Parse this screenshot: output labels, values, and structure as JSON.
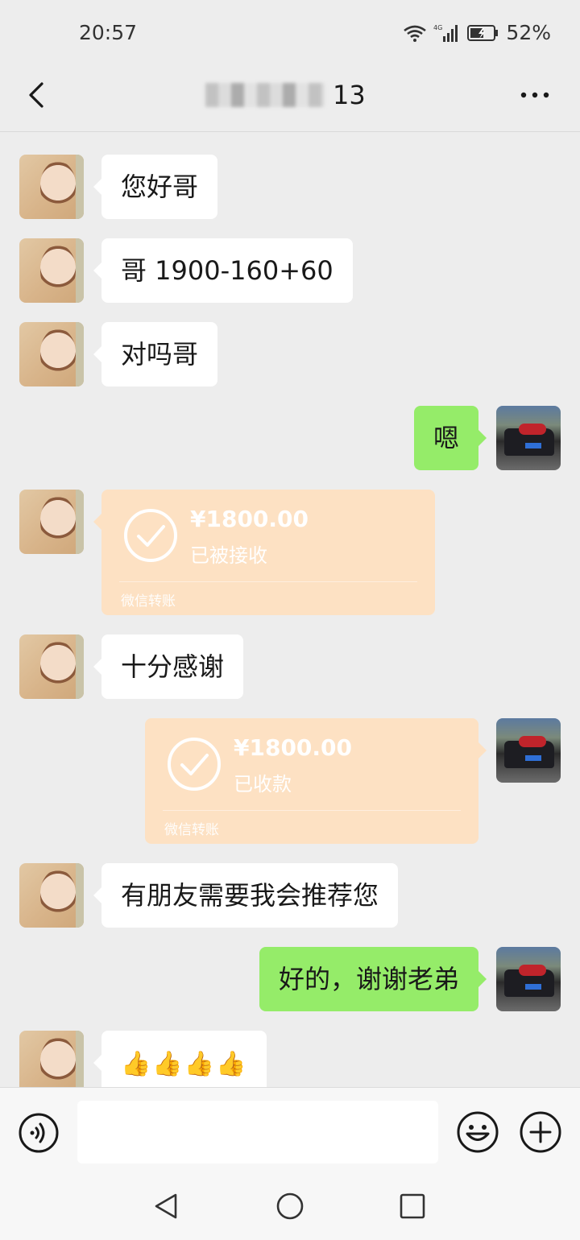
{
  "status_bar": {
    "time": "20:57",
    "network": "4G",
    "battery": "52%"
  },
  "header": {
    "title_suffix": "13"
  },
  "messages": [
    {
      "side": "left",
      "text": "您好哥"
    },
    {
      "side": "left",
      "text": "哥 1900-160+60"
    },
    {
      "side": "left",
      "text": "对吗哥"
    },
    {
      "side": "right",
      "text": "嗯"
    },
    {
      "side": "left",
      "type": "transfer",
      "amount": "¥1800.00",
      "status": "已被接收",
      "brand": "微信转账"
    },
    {
      "side": "left",
      "text": "十分感谢"
    },
    {
      "side": "right",
      "type": "transfer",
      "amount": "¥1800.00",
      "status": "已收款",
      "brand": "微信转账"
    },
    {
      "side": "left",
      "text": "有朋友需要我会推荐您"
    },
    {
      "side": "right",
      "text": "好的，谢谢老弟"
    },
    {
      "side": "left",
      "text": "👍👍👍👍"
    }
  ],
  "input": {
    "placeholder": ""
  },
  "icons": [
    "back-icon",
    "more-icon",
    "check-circle-icon",
    "voice-icon",
    "emoji-icon",
    "plus-icon",
    "nav-back-icon",
    "nav-home-icon",
    "nav-recents-icon"
  ],
  "colors": {
    "background": "#ededed",
    "incoming_bubble": "#ffffff",
    "outgoing_bubble": "#95ec69",
    "transfer_card": "#fde1c3"
  }
}
